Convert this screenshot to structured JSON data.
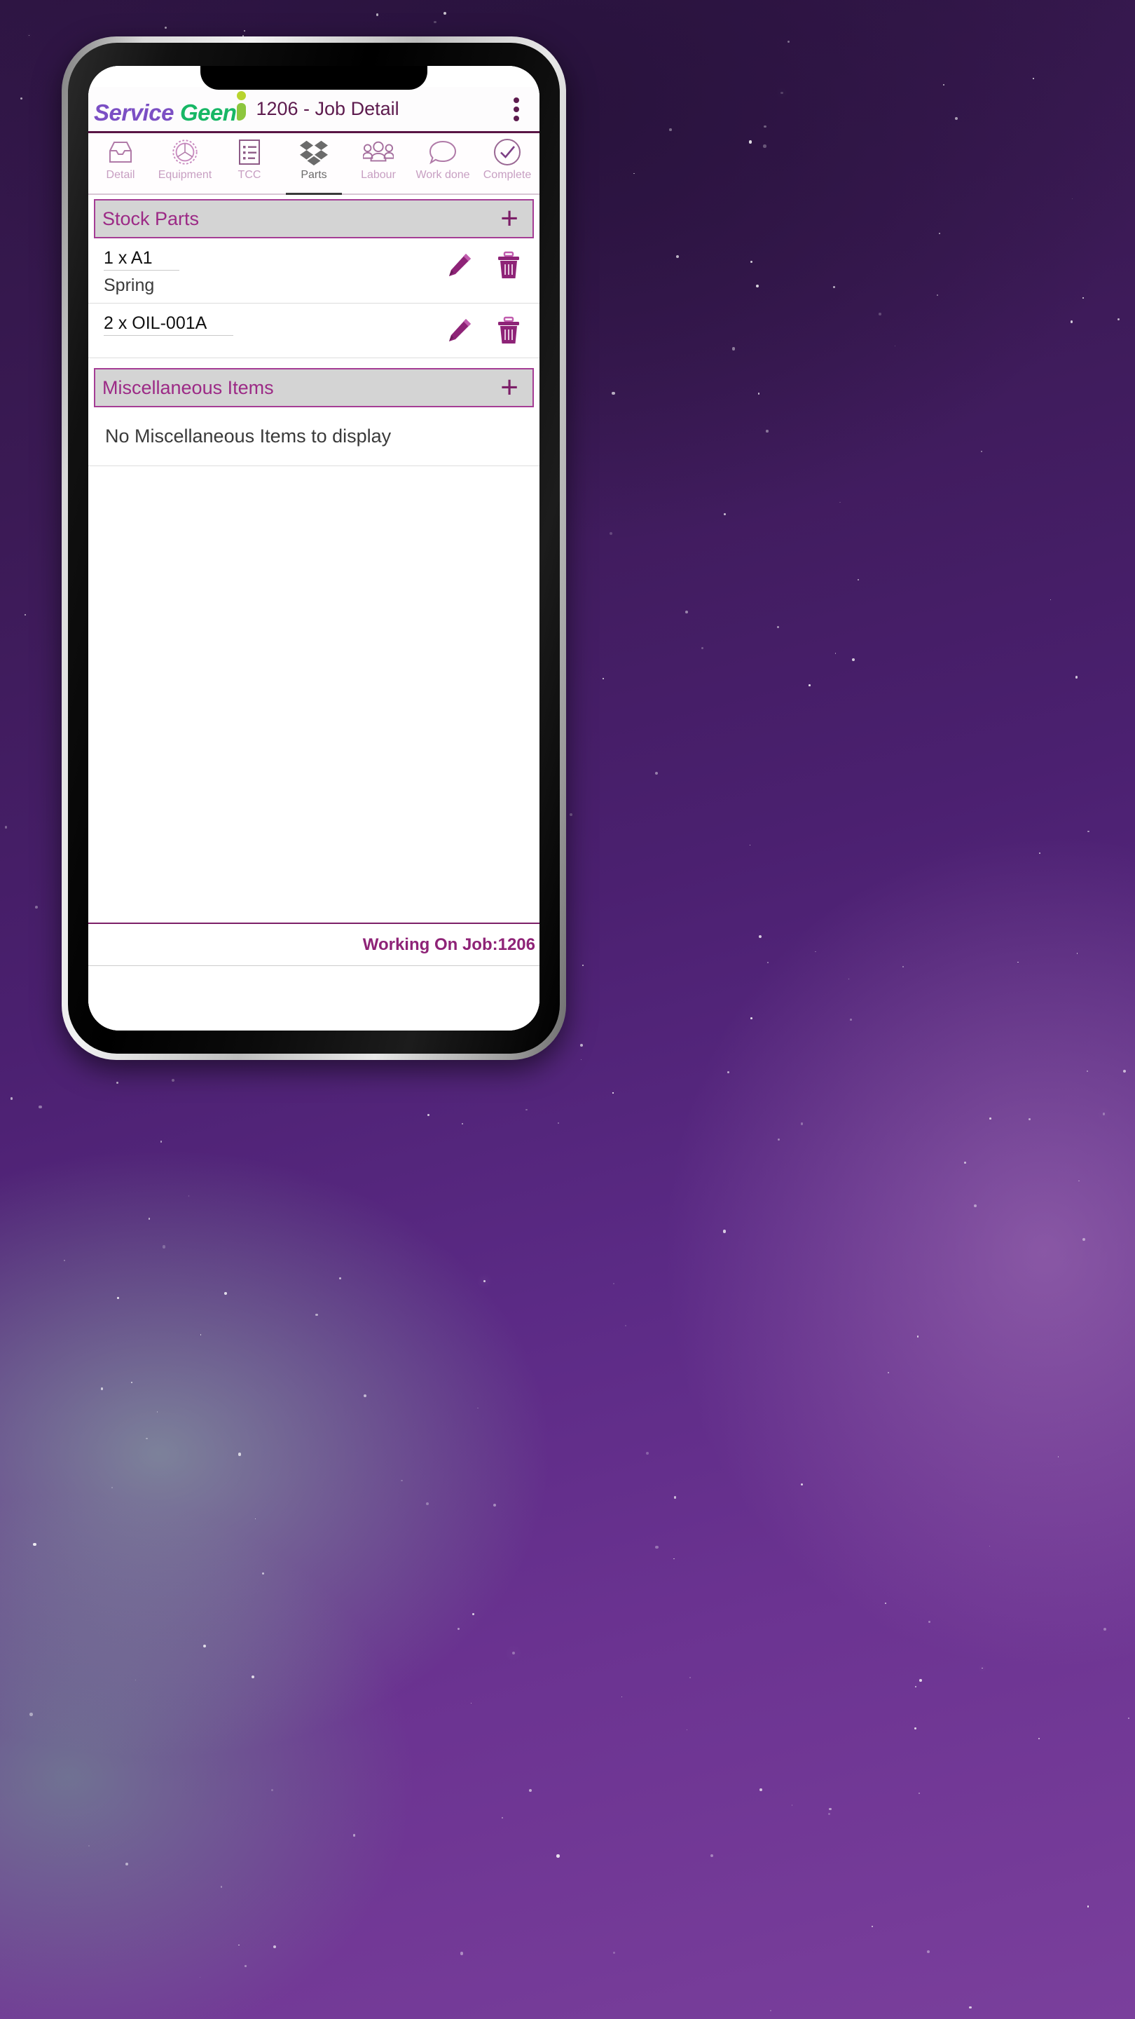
{
  "wallpaper": {
    "accent": "#5b2a85"
  },
  "app": {
    "logo": {
      "part1": "Service",
      "part2": "Geen",
      "glyph": "geeni-figure-i"
    },
    "header_title": "1206 - Job Detail",
    "overflow_icon": "more-vertical-icon",
    "accent_purple": "#7c1f68",
    "accent_magenta": "#9c2a86"
  },
  "tabs": [
    {
      "label": "Detail",
      "icon": "inbox-tray-icon",
      "active": false
    },
    {
      "label": "Equipment",
      "icon": "gear-icon",
      "active": false
    },
    {
      "label": "TCC",
      "icon": "checklist-icon",
      "active": false
    },
    {
      "label": "Parts",
      "icon": "parts-boxes-icon",
      "active": true
    },
    {
      "label": "Labour",
      "icon": "people-group-icon",
      "active": false
    },
    {
      "label": "Work done",
      "icon": "speech-bubble-icon",
      "active": false
    },
    {
      "label": "Complete",
      "icon": "check-circle-icon",
      "active": false
    }
  ],
  "stock_parts": {
    "title": "Stock Parts",
    "add_label": "+",
    "items": [
      {
        "qty_code": "1 x A1",
        "description": "Spring",
        "edit_icon": "pencil-icon",
        "delete_icon": "trash-icon"
      },
      {
        "qty_code": "2 x OIL-001A",
        "description": "",
        "edit_icon": "pencil-icon",
        "delete_icon": "trash-icon"
      }
    ]
  },
  "miscellaneous_items": {
    "title": "Miscellaneous Items",
    "add_label": "+",
    "empty_message": "No Miscellaneous Items to display",
    "items": []
  },
  "footer": {
    "job_status": "Working On Job:1206"
  }
}
